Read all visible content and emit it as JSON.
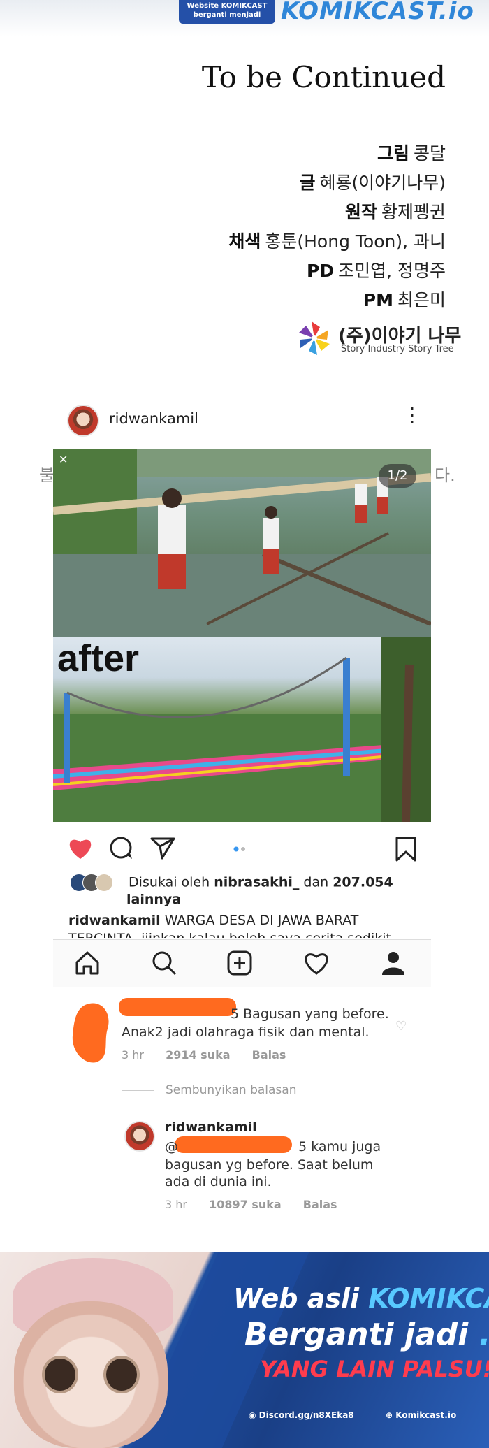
{
  "top_banner": {
    "badge_line1": "Website KOMIKCAST",
    "badge_line2": "berganti menjadi",
    "logo": "KOMIKCAST.io"
  },
  "credits": {
    "title": "To be Continued",
    "rows": [
      {
        "role": "그림",
        "name": "콩달"
      },
      {
        "role": "글",
        "name": "혜룡(이야기나무)"
      },
      {
        "role": "원작",
        "name": "황제펭귄"
      },
      {
        "role": "채색",
        "name": "홍툰(Hong Toon), 과니"
      },
      {
        "role": "PD",
        "name": "조민엽, 정명주"
      },
      {
        "role": "PM",
        "name": "최은미"
      }
    ],
    "publisher_korean": "(주)이야기 나무",
    "publisher_english": "Story Industry Story Tree"
  },
  "background_text": {
    "left": "불",
    "right": "다."
  },
  "instagram": {
    "username": "ridwankamil",
    "photo_counter": "1/2",
    "after_label": "after",
    "likes_prefix": "Disukai oleh",
    "likes_user": "nibrasakhi_",
    "likes_mid": "dan",
    "likes_count": "207.054",
    "likes_suffix": "lainnya",
    "caption_user": "ridwankamil",
    "caption_text": "WARGA DESA DI JAWA BARAT",
    "caption_cut": "TERCINTA, ijinkan kalau boleh saya cerita sedikit",
    "icons": {
      "like": "heart-filled-icon",
      "comment": "comment-icon",
      "share": "send-icon",
      "save": "bookmark-icon",
      "home": "home-icon",
      "search": "search-icon",
      "add": "add-post-icon",
      "activity": "heart-icon",
      "profile": "profile-icon"
    },
    "colors": {
      "like": "#ed4956",
      "dot_active": "#3897f0"
    }
  },
  "comments": {
    "first": {
      "visible_user_tail": "5",
      "text_line1": "Bagusan yang before.",
      "text_line2": "Anak2 jadi olahraga fisik dan mental.",
      "time": "3 hr",
      "likes": "2914 suka",
      "reply": "Balas"
    },
    "hide_replies": "Sembunyikan balasan",
    "second": {
      "user": "ridwankamil",
      "mention_prefix": "@",
      "visible_mention_tail": "5",
      "text_line1": "kamu juga",
      "text_line2": "bagusan yg before. Saat belum",
      "text_line3": "ada di dunia ini.",
      "time": "3 hr",
      "likes": "10897 suka",
      "reply": "Balas"
    }
  },
  "ad_banner": {
    "line1_prefix": "Web asli",
    "line1_site": "KOMIKCAST.SITE",
    "line2_prefix": "Berganti jadi",
    "line2_io": ".IO",
    "line3": "YANG LAIN PALSU!",
    "discord": "Discord.gg/n8XEka8",
    "web": "Komikcast.io",
    "colors": {
      "blue": "#1a3f86",
      "accent": "#58c9ff",
      "warning": "#ff3c4e"
    }
  }
}
